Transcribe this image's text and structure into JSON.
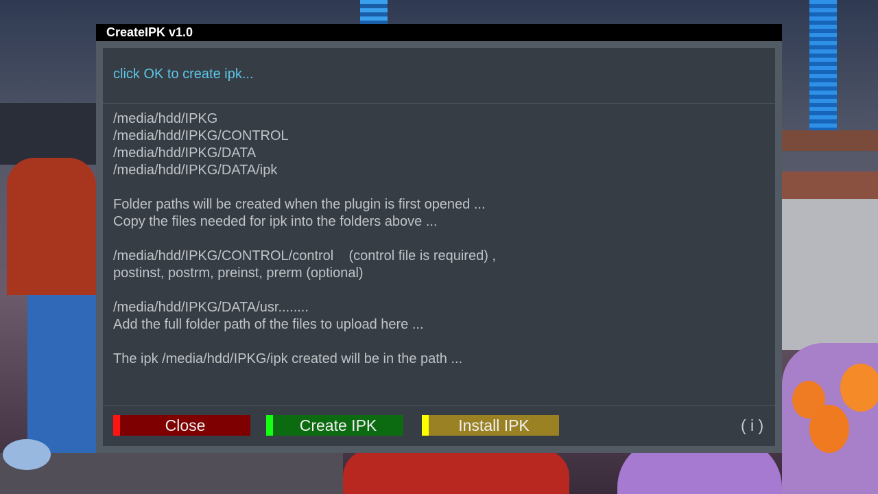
{
  "dialog": {
    "title": "CreateIPK v1.0",
    "header_text": "click OK to create ipk...",
    "lines": [
      "/media/hdd/IPKG",
      "/media/hdd/IPKG/CONTROL",
      "/media/hdd/IPKG/DATA",
      "/media/hdd/IPKG/DATA/ipk",
      "",
      "Folder paths will be created when the plugin is first opened ...",
      "Copy the files needed for ipk into the folders above ...",
      "",
      "/media/hdd/IPKG/CONTROL/control    (control file is required) ,",
      "postinst, postrm, preinst, prerm (optional)",
      "",
      "/media/hdd/IPKG/DATA/usr........",
      "Add the full folder path of the files to upload here ...",
      "",
      "The ipk /media/hdd/IPKG/ipk created will be in the path ..."
    ]
  },
  "buttons": {
    "close_label": "Close",
    "create_label": "Create IPK",
    "install_label": "Install IPK",
    "info_label": "( i )"
  },
  "colors": {
    "header_text": "#5cc6e8",
    "close_bg": "#7e0000",
    "close_marker": "#ff1414",
    "create_bg": "#0c6a10",
    "create_marker": "#15ff15",
    "install_bg": "#9a8224",
    "install_marker": "#ffff00"
  }
}
